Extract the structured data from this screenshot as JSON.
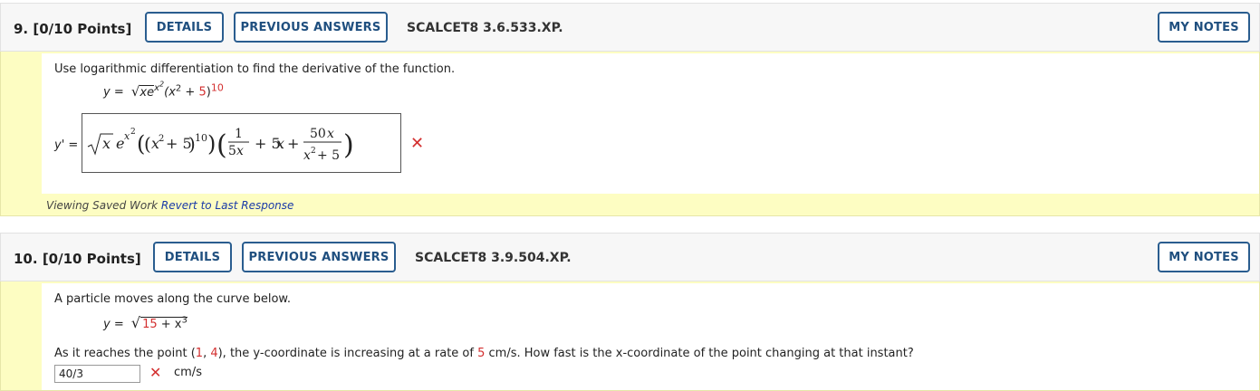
{
  "q9": {
    "number": "9.",
    "points": "[0/10 Points]",
    "details_label": "DETAILS",
    "prev_answers_label": "PREVIOUS ANSWERS",
    "code": "SCALCET8 3.6.533.XP.",
    "notes_label": "MY NOTES",
    "prompt": "Use logarithmic differentiation to find the derivative of the function.",
    "function_lhs": "y =",
    "function_base": "xe",
    "function_exp": "x",
    "function_exp2": "2",
    "function_paren": "(x",
    "function_sq": "2",
    "function_plus": "+",
    "function_five": "5",
    "function_close": ")",
    "function_ten": "10",
    "answer_lhs": "y' =",
    "answer_text": "√x e^(x²) ((x² + 5)^10) (1/(5x) + 5x + 50x/(x² + 5))",
    "footer_viewing": "Viewing Saved Work",
    "footer_revert": "Revert to Last Response"
  },
  "q10": {
    "number": "10.",
    "points": "[0/10 Points]",
    "details_label": "DETAILS",
    "prev_answers_label": "PREVIOUS ANSWERS",
    "code": "SCALCET8 3.9.504.XP.",
    "notes_label": "MY NOTES",
    "prompt": "A particle moves along the curve below.",
    "function_lhs": "y =",
    "function_radicand_a": "15",
    "function_radicand_b": "+ x",
    "function_cube": "3",
    "question_part1": "As it reaches the point (",
    "point_x": "1",
    "comma": ", ",
    "point_y": "4",
    "question_part2": "), the y-coordinate is increasing at a rate of ",
    "rate": "5",
    "question_part3": " cm/s. How fast is the x-coordinate of the point changing at that instant?",
    "answer_value": "40/3",
    "unit": "cm/s"
  },
  "colors": {
    "button_border": "#2a5d8f",
    "body_bg": "#fdfdc2",
    "wrong": "#d32f2f"
  },
  "icons": {
    "wrong": "red-x-icon"
  }
}
